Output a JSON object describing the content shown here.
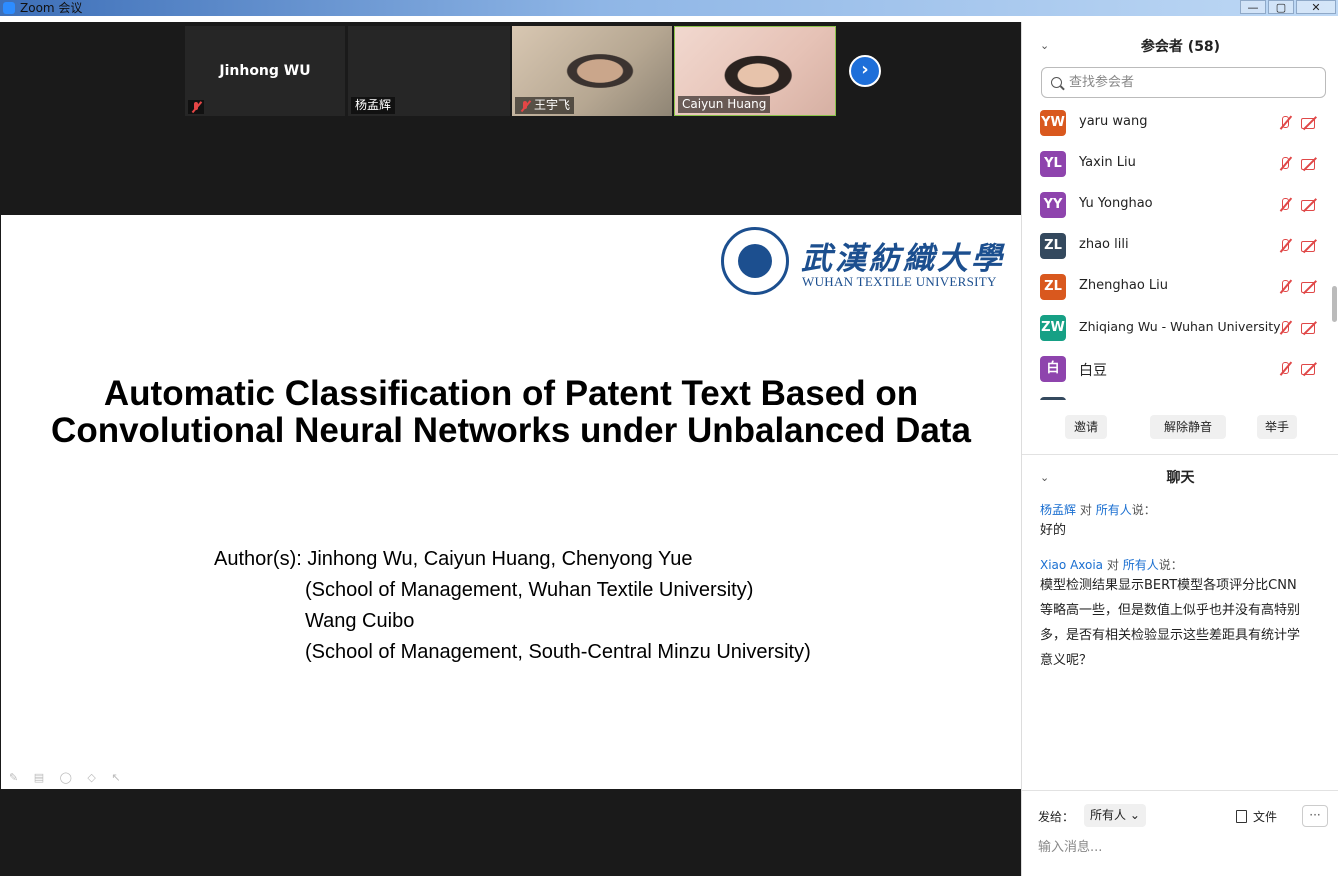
{
  "window": {
    "title": "Zoom 会议",
    "controls": [
      "—",
      "▢",
      "✕"
    ]
  },
  "video_strip": {
    "tiles": [
      {
        "name": "Jinhong WU",
        "label": "",
        "muted": true,
        "type": "name-only"
      },
      {
        "name": "杨孟辉",
        "label": "杨孟辉",
        "muted": false,
        "type": "blank"
      },
      {
        "name": "王宇飞",
        "label": "王宇飞",
        "muted": true,
        "type": "camera"
      },
      {
        "name": "Caiyun Huang",
        "label": "Caiyun Huang",
        "muted": false,
        "type": "camera"
      }
    ],
    "next_label": "›"
  },
  "slide": {
    "logo_cn": "武漢紡織大學",
    "logo_en": "WUHAN TEXTILE UNIVERSITY",
    "title_line1": "Automatic Classification of Patent Text Based on",
    "title_line2": "Convolutional Neural Networks under Unbalanced Data",
    "author_prefix": "Author(s): Jinhong Wu, Caiyun Huang, Chenyong Yue",
    "author_line2": "(School of Management, Wuhan Textile University)",
    "author_line3": "Wang Cuibo",
    "author_line4": "(School of Management, South-Central Minzu University)",
    "annotation_tools": "✎ ▤ ◯ ◇ ↖"
  },
  "participants": {
    "header": "参会者 (58)",
    "search_placeholder": "查找参会者",
    "items": [
      {
        "initials": "YW",
        "name": "yaru  wang",
        "color": "#d9581e"
      },
      {
        "initials": "YL",
        "name": "Yaxin Liu",
        "color": "#8e44ad"
      },
      {
        "initials": "YY",
        "name": "Yu Yonghao",
        "color": "#8e44ad"
      },
      {
        "initials": "ZL",
        "name": "zhao lili",
        "color": "#34495e"
      },
      {
        "initials": "ZL",
        "name": "Zhenghao Liu",
        "color": "#d9581e"
      },
      {
        "initials": "ZW",
        "name": "Zhiqiang Wu - Wuhan University",
        "color": "#16a085"
      },
      {
        "initials": "白",
        "name": "白豆",
        "color": "#8e44ad"
      }
    ],
    "buttons": {
      "invite": "邀请",
      "unmute": "解除静音",
      "raise_hand": "举手"
    }
  },
  "chat": {
    "header": "聊天",
    "messages": [
      {
        "sender": "杨孟辉",
        "to_word": "对",
        "target": "所有人",
        "says": "说：",
        "text": "好的"
      },
      {
        "sender": "Xiao Axoia",
        "to_word": "对",
        "target": "所有人",
        "says": "说：",
        "text": "模型检测结果显示BERT模型各项评分比CNN等略高一些，但是数值上似乎也并没有高特别多，是否有相关检验显示这些差距具有统计学意义呢？"
      }
    ],
    "send_to_label": "发给：",
    "send_to_value": "所有人",
    "file_label": "文件",
    "more_label": "···",
    "input_placeholder": "输入消息..."
  }
}
